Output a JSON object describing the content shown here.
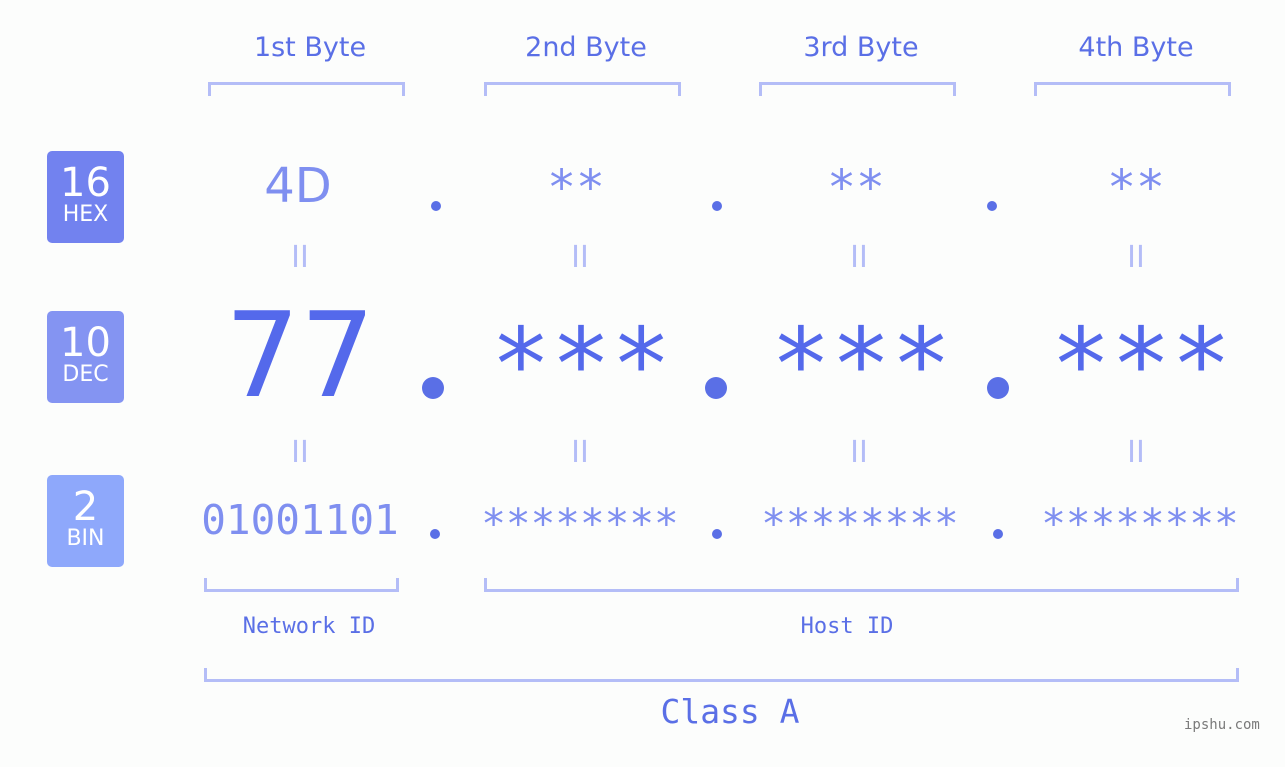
{
  "byte_headers": [
    "1st Byte",
    "2nd Byte",
    "3rd Byte",
    "4th Byte"
  ],
  "badges": [
    {
      "num": "16",
      "label": "HEX",
      "color": "#7282ef"
    },
    {
      "num": "10",
      "label": "DEC",
      "color": "#8494f2"
    },
    {
      "num": "2",
      "label": "BIN",
      "color": "#8ea8fb"
    }
  ],
  "hex": [
    "4D",
    "**",
    "**",
    "**"
  ],
  "dec": [
    "77",
    "***",
    "***",
    "***"
  ],
  "bin": [
    "01001101",
    "********",
    "********",
    "********"
  ],
  "equals": "II",
  "network_id_label": "Network ID",
  "host_id_label": "Host ID",
  "class_label": "Class A",
  "watermark": "ipshu.com",
  "colors": {
    "primary": "#5a6fe6",
    "light": "#7f8ff0",
    "bracket": "#b4bdf7"
  }
}
